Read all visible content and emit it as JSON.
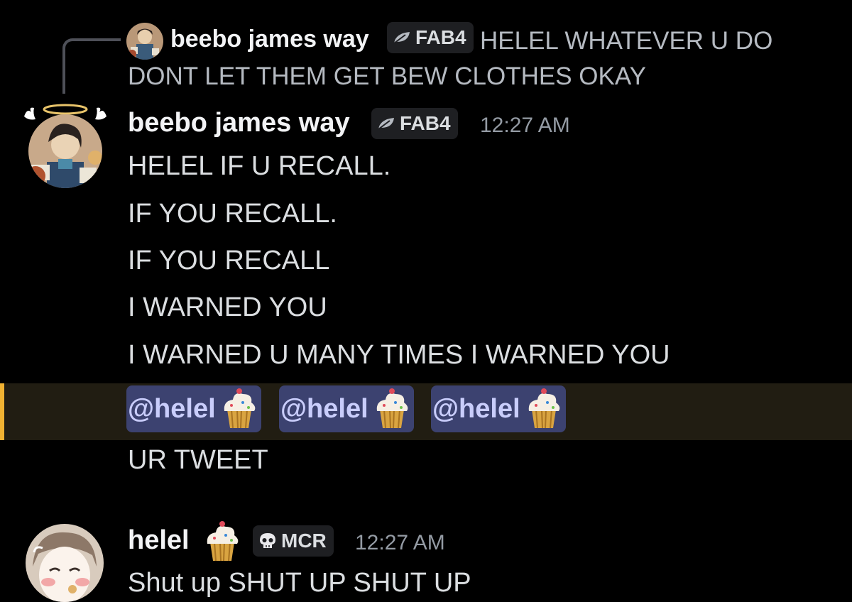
{
  "reply_preview": {
    "author": "beebo james way",
    "tag": "FAB4",
    "text": "HELEL WHATEVER U DO DONT LET THEM GET BEW CLOTHES OKAY"
  },
  "message": {
    "author": "beebo james way",
    "tag": "FAB4",
    "timestamp": "12:27 AM",
    "lines": [
      "HELEL IF U RECALL.",
      "IF YOU RECALL.",
      "IF YOU RECALL",
      "I WARNED YOU",
      "I WARNED U MANY TIMES I WARNED YOU"
    ],
    "mentions": [
      "@helel",
      "@helel",
      "@helel"
    ],
    "after_line": "UR TWEET"
  },
  "next_message": {
    "author": "helel",
    "tag": "MCR",
    "timestamp": "12:27 AM",
    "text": "Shut up SHUT UP SHUT UP"
  },
  "colors": {
    "background": "#000000",
    "mention_bg": "#3c4270",
    "mention_text": "#c9cdfb",
    "highlight_bar": "#f0b232",
    "highlight_bg": "#211d12"
  },
  "icons": {
    "fab4_tag": "leaf-icon",
    "mcr_tag": "skull-icon",
    "mention_emoji": "cupcake-icon"
  }
}
